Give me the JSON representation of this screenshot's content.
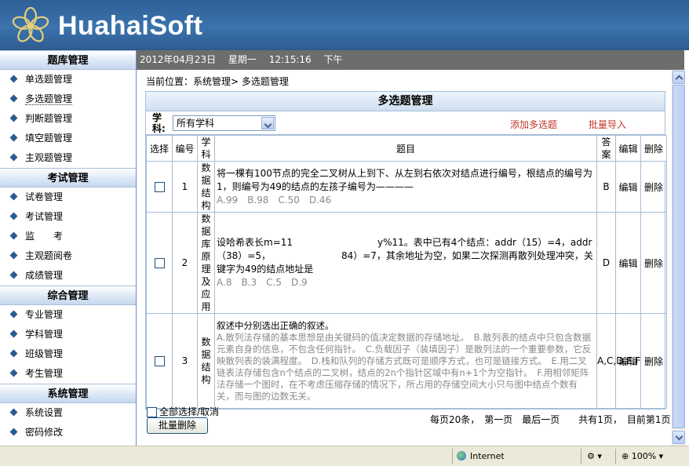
{
  "header": {
    "app_name": "HuahaiSoft"
  },
  "sidebar": {
    "sections": [
      {
        "title": "题库管理",
        "items": [
          "单选题管理",
          "多选题管理",
          "判断题管理",
          "填空题管理",
          "主观题管理"
        ]
      },
      {
        "title": "考试管理",
        "items": [
          "试卷管理",
          "考试管理",
          "监　　考",
          "主观题阅卷",
          "成绩管理"
        ]
      },
      {
        "title": "综合管理",
        "items": [
          "专业管理",
          "学科管理",
          "班级管理",
          "考生管理"
        ]
      },
      {
        "title": "系统管理",
        "items": [
          "系统设置",
          "密码修改"
        ]
      }
    ]
  },
  "datebar": {
    "date": "2012年04月23日",
    "weekday": "星期一",
    "time": "12:15:16",
    "period": "下午"
  },
  "breadcrumb": "当前位置：系统管理> 多选题管理",
  "panel": {
    "title": "多选题管理",
    "subject_label": "学科:",
    "subject_value": "所有学科",
    "add_link": "添加多选题",
    "import_link": "批量导入"
  },
  "table": {
    "headers": {
      "select": "选择",
      "num": "编号",
      "subject": "学科",
      "question": "题目",
      "answer": "答案",
      "edit": "编辑",
      "delete": "删除"
    },
    "rows": [
      {
        "num": "1",
        "subject": "数据结构",
        "question": "将一棵有100节点的完全二叉树从上到下、从左到右依次对结点进行编号，根结点的编号为1，则编号为49的结点的左孩子编号为————",
        "options": "A.99　B.98　C.50　D.46",
        "answer": "B",
        "edit": "编辑",
        "delete": "删除"
      },
      {
        "num": "2",
        "subject": "数据库原理及应用",
        "question": "设哈希表长m=11　　　　　　　　　y%11。表中已有4个结点：addr（15）=4，addr（38）=5，　　　　　　　　84）=7，其余地址为空，如果二次探测再散列处理冲突，关键字为49的结点地址是",
        "options": "A.8　B.3　C.5　D.9",
        "answer": "D",
        "edit": "编辑",
        "delete": "删除"
      },
      {
        "num": "3",
        "subject": "数据结构",
        "question": "叙述中分别选出正确的叙述。",
        "options": "A.散列法存储的基本思想是由关键码的值决定数据的存储地址。　B.散列表的结点中只包含数据元素自身的信息，不包含任何指针。　C.负载因子（装填因子）是散列法的一个重要参数，它反映散列表的装满程度。　D.栈和队列的存储方式既可是顺序方式，也可是链接方式。　E.用二叉链表法存储包含n个结点的二叉树，结点的2n个指针区域中有n+1个为空指针。　F.用相邻矩阵法存储一个图时，在不考虑压缩存储的情况下，所占用的存储空间大小只与图中结点个数有关，而与图的边数无关。",
        "answer": "A,C,D,E,F",
        "edit": "编辑",
        "delete": "删除"
      }
    ]
  },
  "footer": {
    "select_all": "全部选择/取消",
    "batch_delete": "批量删除",
    "pager": "每页20条，　第一页　最后一页　　共有1页，　目前第1页"
  },
  "statusbar": {
    "zone": "Internet",
    "zoom": "100%"
  }
}
